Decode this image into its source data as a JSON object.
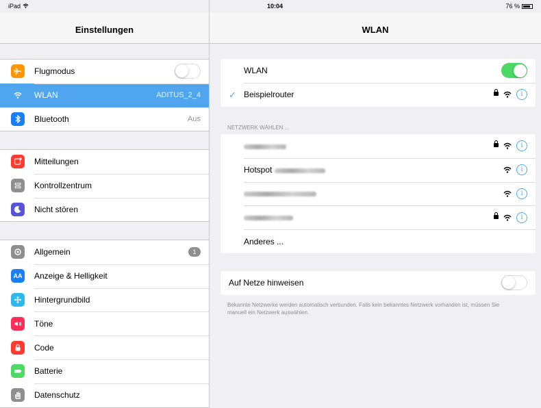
{
  "status_bar": {
    "device": "iPad",
    "time": "10:04",
    "battery": "76 %"
  },
  "sidebar": {
    "title": "Einstellungen",
    "group1": [
      {
        "label": "Flugmodus",
        "icon": "airplane-icon",
        "color": "#ff9500",
        "toggle": "off"
      },
      {
        "label": "WLAN",
        "icon": "wifi-icon",
        "color": "#4fa6ef",
        "detail": "ADITUS_2_4",
        "selected": true
      },
      {
        "label": "Bluetooth",
        "icon": "bluetooth-icon",
        "color": "#1a7ff5",
        "detail": "Aus"
      }
    ],
    "group2": [
      {
        "label": "Mitteilungen",
        "icon": "notifications-icon",
        "color": "#ff3b30"
      },
      {
        "label": "Kontrollzentrum",
        "icon": "control-center-icon",
        "color": "#8e8e93"
      },
      {
        "label": "Nicht stören",
        "icon": "moon-icon",
        "color": "#5856d6"
      }
    ],
    "group3": [
      {
        "label": "Allgemein",
        "icon": "gear-icon",
        "color": "#8e8e93",
        "badge": "1"
      },
      {
        "label": "Anzeige & Helligkeit",
        "icon": "display-icon",
        "color": "#1a7ff5"
      },
      {
        "label": "Hintergrundbild",
        "icon": "wallpaper-icon",
        "color": "#2fb8ee"
      },
      {
        "label": "Töne",
        "icon": "speaker-icon",
        "color": "#ff2d55"
      },
      {
        "label": "Code",
        "icon": "lock-icon",
        "color": "#ff3b30"
      },
      {
        "label": "Batterie",
        "icon": "battery-icon",
        "color": "#4cd964"
      },
      {
        "label": "Datenschutz",
        "icon": "hand-icon",
        "color": "#8e8e93"
      }
    ]
  },
  "main": {
    "title": "WLAN",
    "wlan_label": "WLAN",
    "wlan_toggle": "on",
    "connected_network": "Beispielrouter",
    "section_label": "NETZWERK WÄHLEN ...",
    "networks": [
      {
        "label": "",
        "locked": true
      },
      {
        "label": "Hotspot",
        "locked": false
      },
      {
        "label": "",
        "locked": false
      },
      {
        "label": "",
        "locked": true
      }
    ],
    "other_label": "Anderes ...",
    "ask_label": "Auf Netze hinweisen",
    "ask_toggle": "off",
    "footnote": "Bekannte Netzwerke werden automatisch verbunden. Falls kein bekanntes Netzwerk vorhanden ist, müssen Sie manuell ein Netzwerk auswählen.",
    "info_glyph": "i"
  }
}
